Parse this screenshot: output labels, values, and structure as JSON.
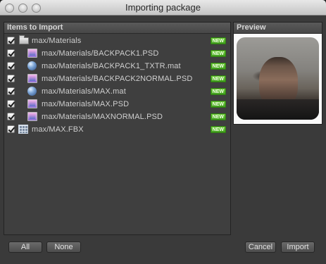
{
  "window": {
    "title": "Importing package"
  },
  "items_panel": {
    "header": "Items to Import",
    "rows": [
      {
        "label": "max/Materials",
        "icon": "folder-icon",
        "checked": true,
        "new": "NEW"
      },
      {
        "label": "max/Materials/BACKPACK1.PSD",
        "icon": "psd-image-icon",
        "checked": true,
        "new": "NEW"
      },
      {
        "label": "max/Materials/BACKPACK1_TXTR.mat",
        "icon": "material-sphere-icon",
        "checked": true,
        "new": "NEW"
      },
      {
        "label": "max/Materials/BACKPACK2NORMAL.PSD",
        "icon": "psd-image-icon",
        "checked": true,
        "new": "NEW"
      },
      {
        "label": "max/Materials/MAX.mat",
        "icon": "material-sphere-icon",
        "checked": true,
        "new": "NEW"
      },
      {
        "label": "max/Materials/MAX.PSD",
        "icon": "psd-image-icon",
        "checked": true,
        "new": "NEW"
      },
      {
        "label": "max/Materials/MAXNORMAL.PSD",
        "icon": "psd-image-icon",
        "checked": true,
        "new": "NEW"
      },
      {
        "label": "max/MAX.FBX",
        "icon": "mesh-grid-icon",
        "checked": true,
        "new": "NEW"
      }
    ]
  },
  "preview_panel": {
    "header": "Preview"
  },
  "buttons": {
    "all": "All",
    "none": "None",
    "cancel": "Cancel",
    "import": "Import"
  },
  "colors": {
    "new_badge": "#4faf26",
    "panel_bg": "#3f3f3f",
    "window_bg": "#3a3a3a"
  }
}
